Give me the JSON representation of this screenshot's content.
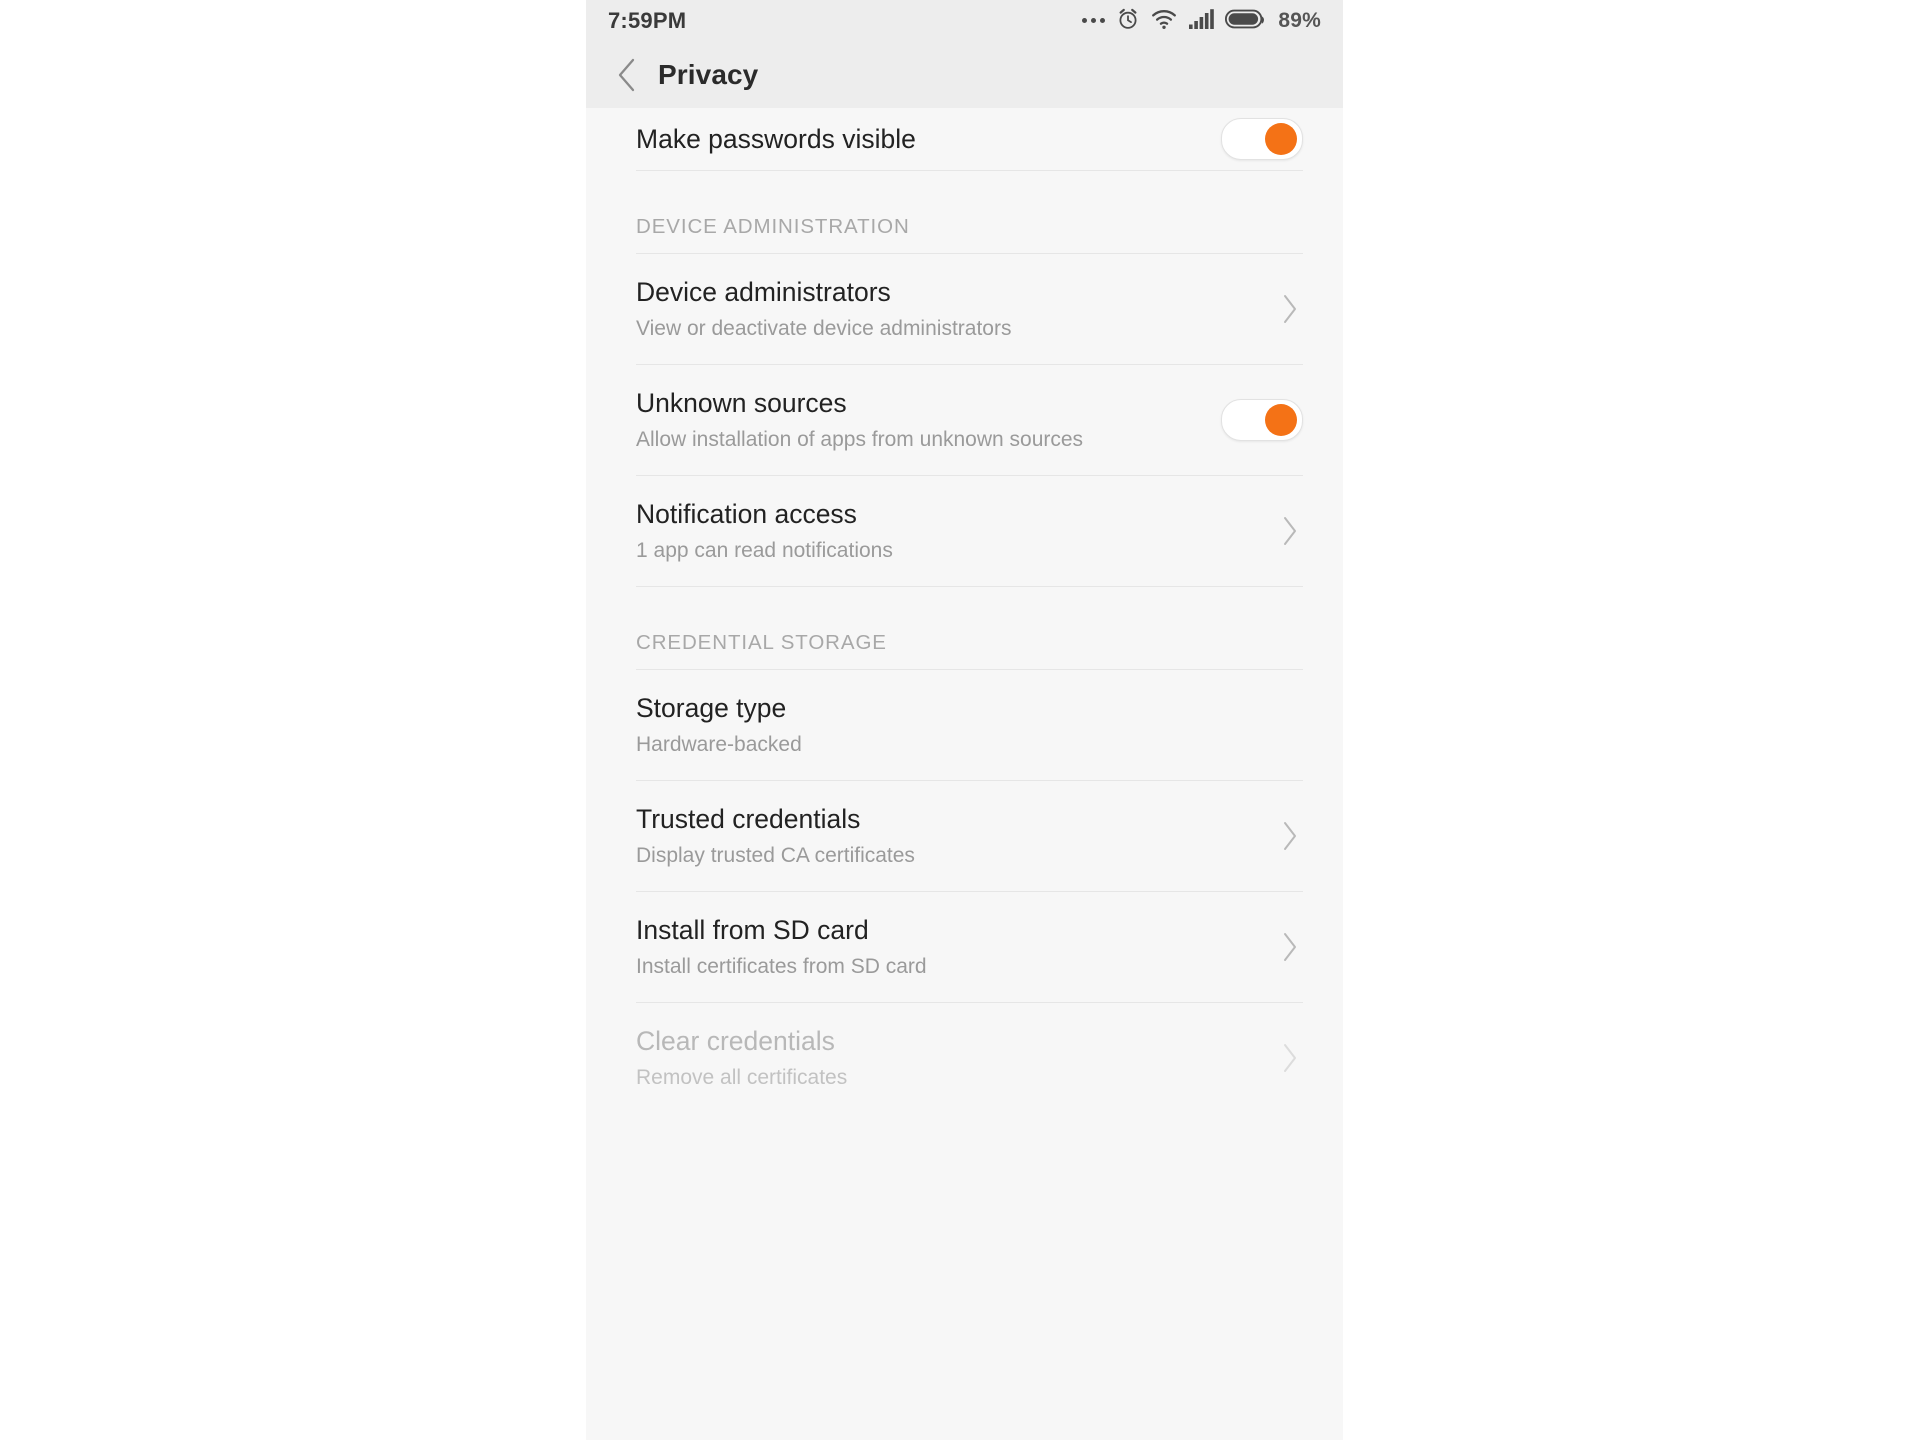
{
  "status_bar": {
    "time": "7:59PM",
    "battery_percent": "89%",
    "icons": [
      "ellipsis-icon",
      "alarm-clock-icon",
      "wifi-icon",
      "cellular-signal-icon",
      "battery-icon"
    ]
  },
  "header": {
    "back_icon": "chevron-left-icon",
    "title": "Privacy"
  },
  "colors": {
    "accent": "#f47216",
    "title_text": "#222222",
    "subtitle_text": "#9a9a9a",
    "disabled_text": "#b8b8b8",
    "section_header_text": "#a8a8a8",
    "bar_background": "#ededed",
    "page_background": "#f7f7f7",
    "divider": "#e6e6e6"
  },
  "rows": [
    {
      "id": "make-passwords-visible",
      "title": "Make passwords visible",
      "subtitle": "",
      "control": "toggle",
      "toggle_state": "on",
      "disabled": false
    }
  ],
  "sections": [
    {
      "id": "device-administration",
      "header": "DEVICE ADMINISTRATION",
      "rows": [
        {
          "id": "device-administrators",
          "title": "Device administrators",
          "subtitle": "View or deactivate device administrators",
          "control": "chevron",
          "disabled": false
        },
        {
          "id": "unknown-sources",
          "title": "Unknown sources",
          "subtitle": "Allow installation of apps from unknown sources",
          "control": "toggle",
          "toggle_state": "on",
          "disabled": false
        },
        {
          "id": "notification-access",
          "title": "Notification access",
          "subtitle": "1 app can read notifications",
          "control": "chevron",
          "disabled": false
        }
      ]
    },
    {
      "id": "credential-storage",
      "header": "CREDENTIAL STORAGE",
      "rows": [
        {
          "id": "storage-type",
          "title": "Storage type",
          "subtitle": "Hardware-backed",
          "control": "none",
          "disabled": false
        },
        {
          "id": "trusted-credentials",
          "title": "Trusted credentials",
          "subtitle": "Display trusted CA certificates",
          "control": "chevron",
          "disabled": false
        },
        {
          "id": "install-from-sd-card",
          "title": "Install from SD card",
          "subtitle": "Install certificates from SD card",
          "control": "chevron",
          "disabled": false
        },
        {
          "id": "clear-credentials",
          "title": "Clear credentials",
          "subtitle": "Remove all certificates",
          "control": "chevron",
          "disabled": true
        }
      ]
    }
  ]
}
